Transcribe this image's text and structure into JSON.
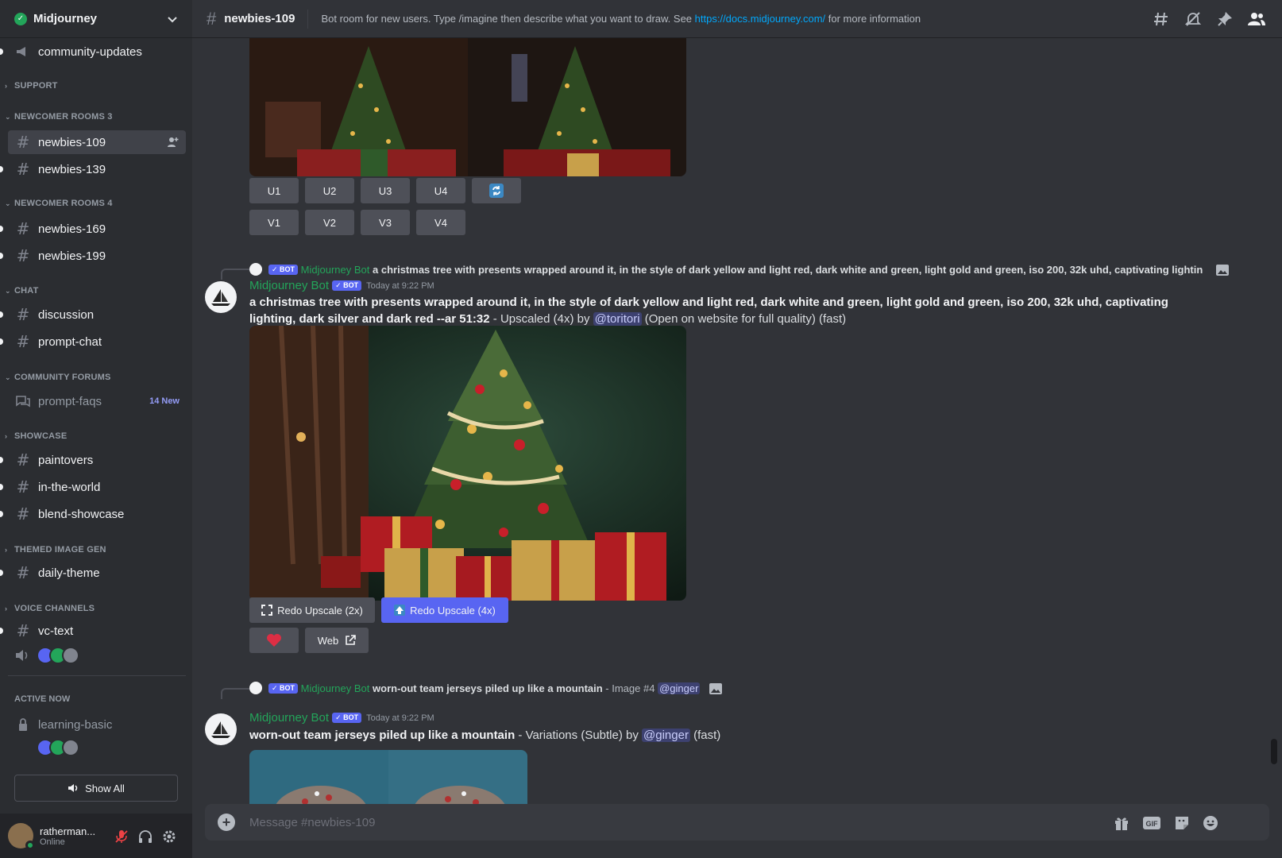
{
  "server": {
    "name": "Midjourney"
  },
  "sidebar": {
    "channels": {
      "community_updates": "community-updates",
      "newbies_109": "newbies-109",
      "newbies_139": "newbies-139",
      "newbies_169": "newbies-169",
      "newbies_199": "newbies-199",
      "discussion": "discussion",
      "prompt_chat": "prompt-chat",
      "prompt_faqs": "prompt-faqs",
      "paintovers": "paintovers",
      "in_the_world": "in-the-world",
      "blend_showcase": "blend-showcase",
      "daily_theme": "daily-theme",
      "vc_text": "vc-text"
    },
    "categories": {
      "support": "SUPPORT",
      "newcomer3": "NEWCOMER ROOMS 3",
      "newcomer4": "NEWCOMER ROOMS 4",
      "chat": "CHAT",
      "forums": "COMMUNITY FORUMS",
      "showcase": "SHOWCASE",
      "themed": "THEMED IMAGE GEN",
      "voice": "VOICE CHANNELS"
    },
    "prompt_faqs_new": "14 New",
    "active_now": "ACTIVE NOW",
    "active_channel": "learning-basic",
    "show_all": "Show All"
  },
  "user": {
    "name": "ratherman...",
    "status": "Online"
  },
  "topbar": {
    "channel": "newbies-109",
    "topic_pre": "Bot room for new users. Type /imagine then describe what you want to draw. See ",
    "topic_link": "https://docs.midjourney.com/",
    "topic_post": " for more information"
  },
  "buttons": {
    "u1": "U1",
    "u2": "U2",
    "u3": "U3",
    "u4": "U4",
    "v1": "V1",
    "v2": "V2",
    "v3": "V3",
    "v4": "V4",
    "redo2x": "Redo Upscale (2x)",
    "redo4x": "Redo Upscale (4x)",
    "web": "Web"
  },
  "messages": [
    {
      "author": "Midjourney Bot",
      "bot_tag": "✓ BOT",
      "timestamp": "Today at 9:22 PM",
      "reply_author": "Midjourney Bot",
      "reply_text": "a christmas tree with presents wrapped around it, in the style of dark yellow and light red, dark white and green, light gold and green, iso 200, 32k uhd, captivating lighting",
      "prompt": "a christmas tree with presents wrapped around it, in the style of dark yellow and light red, dark white and green, light gold and green, iso 200, 32k uhd, captivating lighting, dark silver and dark red --ar 51:32",
      "suffix_pre": " - Upscaled (4x) by ",
      "mention": "@toritori",
      "suffix_post": " (Open on website for full quality) (fast)"
    },
    {
      "author": "Midjourney Bot",
      "bot_tag": "✓ BOT",
      "timestamp": "Today at 9:22 PM",
      "reply_author": "Midjourney Bot",
      "reply_text": "worn-out team jerseys piled up like a mountain",
      "reply_suffix": " - Image #4 ",
      "reply_mention": "@ginger",
      "prompt": "worn-out team jerseys piled up like a mountain",
      "suffix_pre": " - Variations (Subtle) by ",
      "mention": "@ginger",
      "suffix_post": " (fast)"
    }
  ],
  "composer": {
    "placeholder": "Message #newbies-109"
  },
  "colors": {
    "accent": "#5865f2",
    "bot_green": "#23a55a",
    "link": "#00a8fc"
  }
}
